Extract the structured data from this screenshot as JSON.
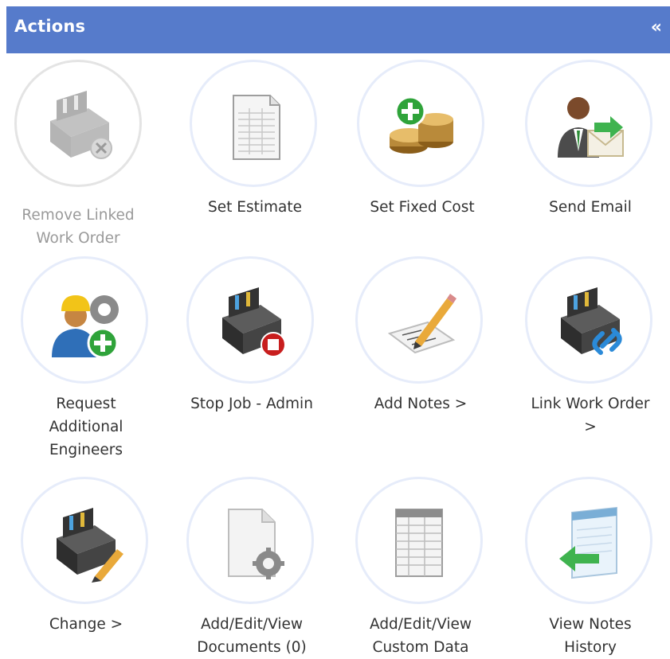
{
  "panel": {
    "title": "Actions",
    "collapse_glyph": "«"
  },
  "tiles": [
    {
      "label": "Remove Linked\nWork Order",
      "icon": "toolbox-remove-icon",
      "disabled": true
    },
    {
      "label": "Set Estimate",
      "icon": "spreadsheet-icon",
      "disabled": false
    },
    {
      "label": "Set Fixed Cost",
      "icon": "coins-add-icon",
      "disabled": false
    },
    {
      "label": "Send Email",
      "icon": "person-email-icon",
      "disabled": false
    },
    {
      "label": "Request\nAdditional\nEngineers",
      "icon": "engineer-add-icon",
      "disabled": false
    },
    {
      "label": "Stop Job - Admin",
      "icon": "toolbox-stop-icon",
      "disabled": false
    },
    {
      "label": "Add Notes >",
      "icon": "note-pencil-icon",
      "disabled": false
    },
    {
      "label": "Link Work Order\n>",
      "icon": "toolbox-link-icon",
      "disabled": false
    },
    {
      "label": "Change >",
      "icon": "toolbox-edit-icon",
      "disabled": false
    },
    {
      "label": "Add/Edit/View\nDocuments (0)",
      "icon": "document-gear-icon",
      "disabled": false
    },
    {
      "label": "Add/Edit/View\nCustom Data",
      "icon": "datasheet-icon",
      "disabled": false
    },
    {
      "label": "View Notes\nHistory",
      "icon": "notepad-back-icon",
      "disabled": false
    }
  ]
}
